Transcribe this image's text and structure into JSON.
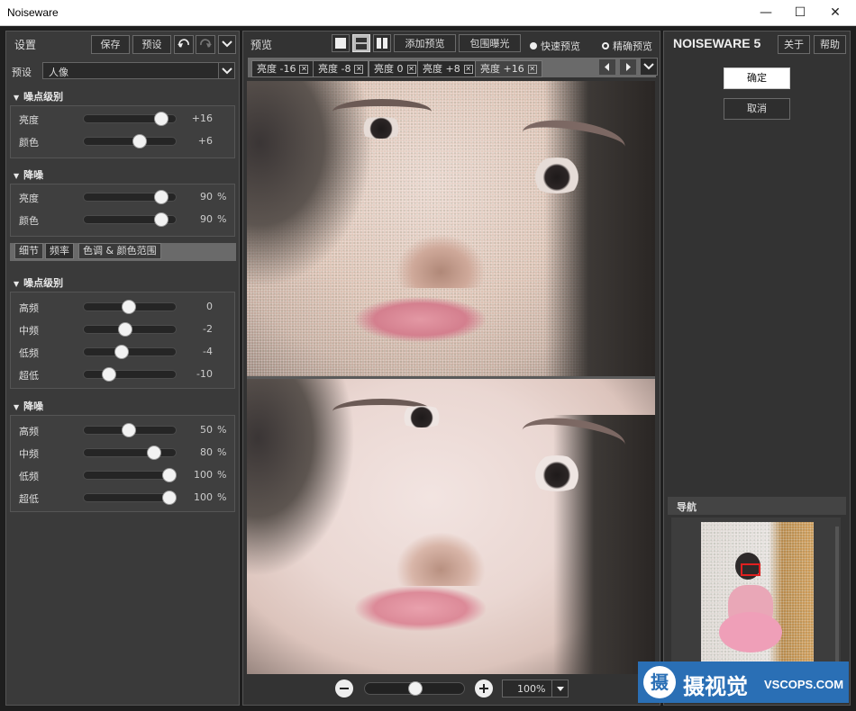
{
  "window": {
    "title": "Noiseware",
    "minimize": "—",
    "maximize": "☐",
    "close": "✕"
  },
  "left": {
    "settings_label": "设置",
    "save_label": "保存",
    "preset_btn_label": "预设",
    "preset_label": "预设",
    "preset_value": "人像",
    "noise_level_header": "噪点级别",
    "noise_level": [
      {
        "label": "亮度",
        "value": "+16",
        "pos": 0.86
      },
      {
        "label": "颜色",
        "value": "+6",
        "pos": 0.62
      }
    ],
    "denoise_header": "降噪",
    "denoise": [
      {
        "label": "亮度",
        "value": "90",
        "unit": "%",
        "pos": 0.86
      },
      {
        "label": "颜色",
        "value": "90",
        "unit": "%",
        "pos": 0.86
      }
    ],
    "tabs": [
      "细节",
      "频率",
      "色调 & 颜色范围"
    ],
    "freq_noise_header": "噪点级别",
    "freq_noise": [
      {
        "label": "高频",
        "value": "0",
        "pos": 0.5
      },
      {
        "label": "中频",
        "value": "-2",
        "pos": 0.46
      },
      {
        "label": "低频",
        "value": "-4",
        "pos": 0.42
      },
      {
        "label": "超低",
        "value": "-10",
        "pos": 0.28
      }
    ],
    "freq_denoise_header": "降噪",
    "freq_denoise": [
      {
        "label": "高频",
        "value": "50",
        "unit": "%",
        "pos": 0.5
      },
      {
        "label": "中频",
        "value": "80",
        "unit": "%",
        "pos": 0.78
      },
      {
        "label": "低频",
        "value": "100",
        "unit": "%",
        "pos": 0.95
      },
      {
        "label": "超低",
        "value": "100",
        "unit": "%",
        "pos": 0.95
      }
    ]
  },
  "center": {
    "preview_label": "预览",
    "add_preview_label": "添加预览",
    "bracket_label": "包围曝光",
    "fast_preview_label": "快速预览",
    "accurate_preview_label": "精确预览",
    "tabs": [
      "亮度 -16",
      "亮度 -8",
      "亮度 0",
      "亮度 +8",
      "亮度 +16"
    ],
    "zoom_value": "100%",
    "zoom_pos": 0.5
  },
  "right": {
    "logo": "NOISEWARE 5",
    "about_label": "关于",
    "help_label": "帮助",
    "ok_label": "确定",
    "cancel_label": "取消",
    "nav_label": "导航"
  },
  "watermark": {
    "text": "摄视觉",
    "domain": "VSCOPS.COM"
  }
}
